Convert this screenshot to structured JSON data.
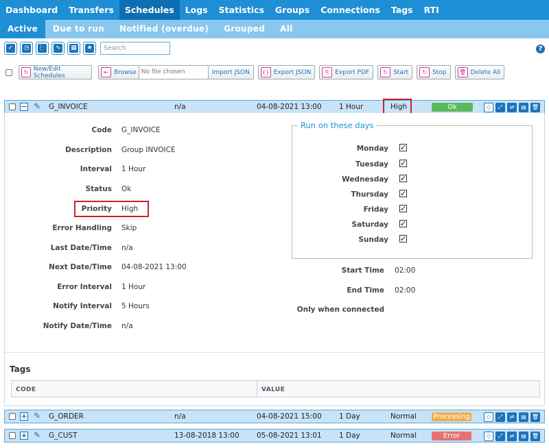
{
  "topnav": [
    "Dashboard",
    "Transfers",
    "Schedules",
    "Logs",
    "Statistics",
    "Groups",
    "Connections",
    "Tags",
    "RTI"
  ],
  "topnav_active": "Schedules",
  "subnav": [
    "Active",
    "Due to run",
    "Notified (overdue)",
    "Grouped",
    "All"
  ],
  "subnav_active": "Active",
  "search_placeholder": "Search",
  "help": "?",
  "actions": {
    "new_edit": "New/Edit Schedules",
    "browse": "Browse",
    "file_placeholder": "No file chosen",
    "import_json": "Import JSON",
    "export_json": "Export JSON",
    "export_pdf": "Export PDF",
    "start": "Start",
    "stop": "Stop",
    "delete_all": "Delete All"
  },
  "rows": [
    {
      "name": "G_INVOICE",
      "last": "n/a",
      "next": "04-08-2021 13:00",
      "interval": "1 Hour",
      "priority": "High",
      "status": "Ok",
      "status_color": "#5cb85c",
      "expanded": true
    },
    {
      "name": "G_ORDER",
      "last": "n/a",
      "next": "04-08-2021 15:00",
      "interval": "1 Day",
      "priority": "Normal",
      "status": "Processing",
      "status_color": "#f0ad4e",
      "expanded": false
    },
    {
      "name": "G_CUST",
      "last": "13-08-2018 13:00",
      "next": "05-08-2021 13:01",
      "interval": "1 Day",
      "priority": "Normal",
      "status": "Error",
      "status_color": "#e57373",
      "expanded": false
    }
  ],
  "detail": {
    "fields": [
      {
        "label": "Code",
        "value": "G_INVOICE"
      },
      {
        "label": "Description",
        "value": "Group INVOICE"
      },
      {
        "label": "Interval",
        "value": "1 Hour"
      },
      {
        "label": "Status",
        "value": "Ok"
      },
      {
        "label": "Priority",
        "value": "High"
      },
      {
        "label": "Error Handling",
        "value": "Skip"
      },
      {
        "label": "Last Date/Time",
        "value": "n/a"
      },
      {
        "label": "Next Date/Time",
        "value": "04-08-2021 13:00"
      },
      {
        "label": "Error Interval",
        "value": "1 Hour"
      },
      {
        "label": "Notify Interval",
        "value": "5 Hours"
      },
      {
        "label": "Notify Date/Time",
        "value": "n/a"
      }
    ],
    "days_title": "Run on these days",
    "days": [
      "Monday",
      "Tuesday",
      "Wednesday",
      "Thursday",
      "Friday",
      "Saturday",
      "Sunday"
    ],
    "days_checked": [
      true,
      true,
      true,
      true,
      true,
      true,
      true
    ],
    "start_time_label": "Start Time",
    "start_time": "02:00",
    "end_time_label": "End Time",
    "end_time": "02:00",
    "only_connected_label": "Only when connected",
    "tags_title": "Tags",
    "tags_columns": [
      "CODE",
      "VALUE"
    ]
  }
}
